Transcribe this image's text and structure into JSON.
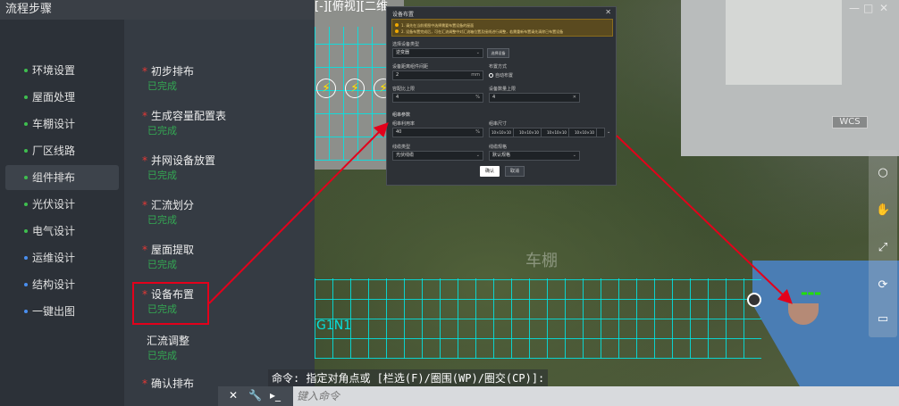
{
  "app": {
    "title": "流程步骤"
  },
  "nav": {
    "items": [
      {
        "label": "环境设置",
        "dot": "green",
        "active": false
      },
      {
        "label": "屋面处理",
        "dot": "green",
        "active": false
      },
      {
        "label": "车棚设计",
        "dot": "green",
        "active": false
      },
      {
        "label": "厂区线路",
        "dot": "green",
        "active": false
      },
      {
        "label": "组件排布",
        "dot": "green",
        "active": true
      },
      {
        "label": "光伏设计",
        "dot": "green",
        "active": false
      },
      {
        "label": "电气设计",
        "dot": "green",
        "active": false
      },
      {
        "label": "运维设计",
        "dot": "blue",
        "active": false
      },
      {
        "label": "结构设计",
        "dot": "blue",
        "active": false
      },
      {
        "label": "一键出图",
        "dot": "blue",
        "active": false
      }
    ]
  },
  "steps": [
    {
      "name": "初步排布",
      "required": true,
      "status": "已完成"
    },
    {
      "name": "生成容量配置表",
      "required": true,
      "status": "已完成"
    },
    {
      "name": "并网设备放置",
      "required": true,
      "status": "已完成"
    },
    {
      "name": "汇流划分",
      "required": true,
      "status": "已完成"
    },
    {
      "name": "屋面提取",
      "required": true,
      "status": "已完成"
    },
    {
      "name": "设备布置",
      "required": true,
      "status": "已完成"
    },
    {
      "name": "汇流调整",
      "required": false,
      "status": "已完成"
    },
    {
      "name": "确认排布",
      "required": true,
      "status": ""
    }
  ],
  "viewport": {
    "view_label": "[-][俯视][二维",
    "roof_label": "车棚",
    "grid_label": "G1N1",
    "wcs_label": "WCS",
    "window_controls": [
      "—",
      "□",
      "✕"
    ]
  },
  "dialog": {
    "title": "设备布置",
    "close_label": "✕",
    "warnings": [
      "1. 请先在当前视图中选择需要布置设备的屋面",
      "2. 设备布置完成后，可在汇流调整中对汇流箱位置及接线进行调整，若需重新布置请先清除已布置设备"
    ],
    "device_type_label": "选择设备类型",
    "device_type_value": "逆变器",
    "select_btn_label": "选择设备",
    "spacing_label": "设备距离组件间距",
    "spacing_value": "2",
    "spacing_unit": "mm",
    "layout_mode_label": "布置方式",
    "layout_mode_option": "自动布置",
    "max_ratio_label": "容配比上限",
    "max_ratio_value": "4",
    "max_ratio_unit": "%",
    "max_count_label": "设备数量上限",
    "max_count_value": "4",
    "section_label": "组串参数",
    "string_ratio_label": "组串利用率",
    "string_ratio_value": "40",
    "string_ratio_unit": "%",
    "string_size_label": "组串尺寸",
    "string_size_tabs": [
      "10×10×10",
      "10×10×10",
      "10×10×10",
      "10×10×10"
    ],
    "cable_type_label": "线缆类型",
    "cable_type_value": "光伏线缆",
    "cable_spec_label": "线缆规格",
    "cable_spec_value": "默认规格",
    "ok_label": "确认",
    "cancel_label": "取消"
  },
  "command": {
    "prompt": "命令: 指定对角点或 [栏选(F)/圈围(WP)/圈交(CP)]:",
    "placeholder": "键入命令"
  },
  "colors": {
    "accent_red": "#e3001b",
    "status_green": "#34a853",
    "grid_cyan": "#00e6e6"
  },
  "icons": {
    "command_close": "close-icon",
    "command_settings": "wrench-icon",
    "command_terminal": "terminal-icon"
  }
}
